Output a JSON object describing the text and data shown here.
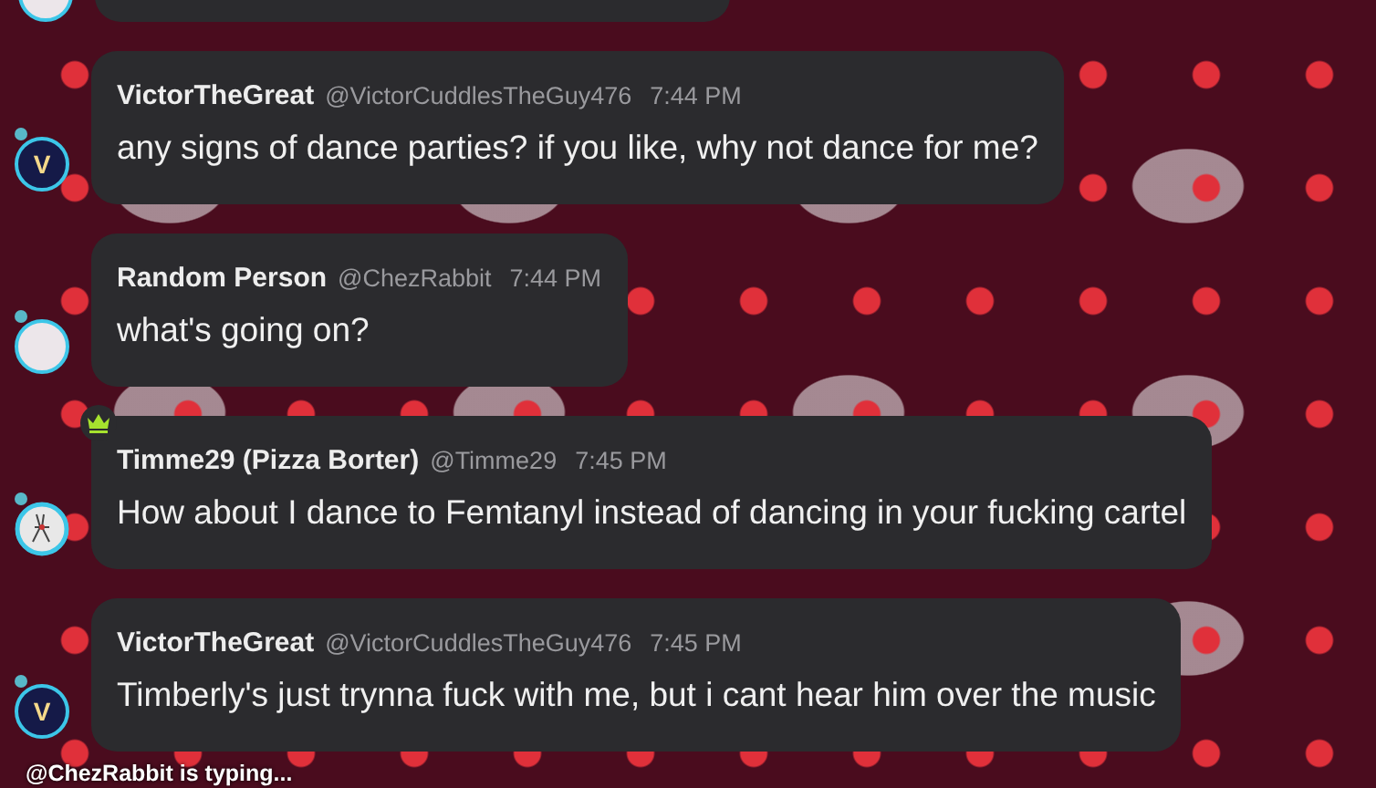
{
  "messages": [
    {
      "author": "VictorTheGreat",
      "handle": "@VictorCuddlesTheGuy476",
      "time": "7:44 PM",
      "text": "any signs of dance parties? if you like, why not dance for me?",
      "avatar": {
        "kind": "letter",
        "letter": "V"
      },
      "crown": false
    },
    {
      "author": "Random Person",
      "handle": "@ChezRabbit",
      "time": "7:44 PM",
      "text": "what's going on?",
      "avatar": {
        "kind": "image"
      },
      "crown": false
    },
    {
      "author": "Timme29 (Pizza Borter)",
      "handle": "@Timme29",
      "time": "7:45 PM",
      "text": "How about I dance to Femtanyl instead of dancing in your fucking cartel",
      "avatar": {
        "kind": "sketch"
      },
      "crown": true
    },
    {
      "author": "VictorTheGreat",
      "handle": "@VictorCuddlesTheGuy476",
      "time": "7:45 PM",
      "text": "Timberly's just trynna fuck with me, but i cant hear him over the music",
      "avatar": {
        "kind": "letter",
        "letter": "V"
      },
      "crown": false
    }
  ],
  "typing_indicator": "@ChezRabbit is typing..."
}
